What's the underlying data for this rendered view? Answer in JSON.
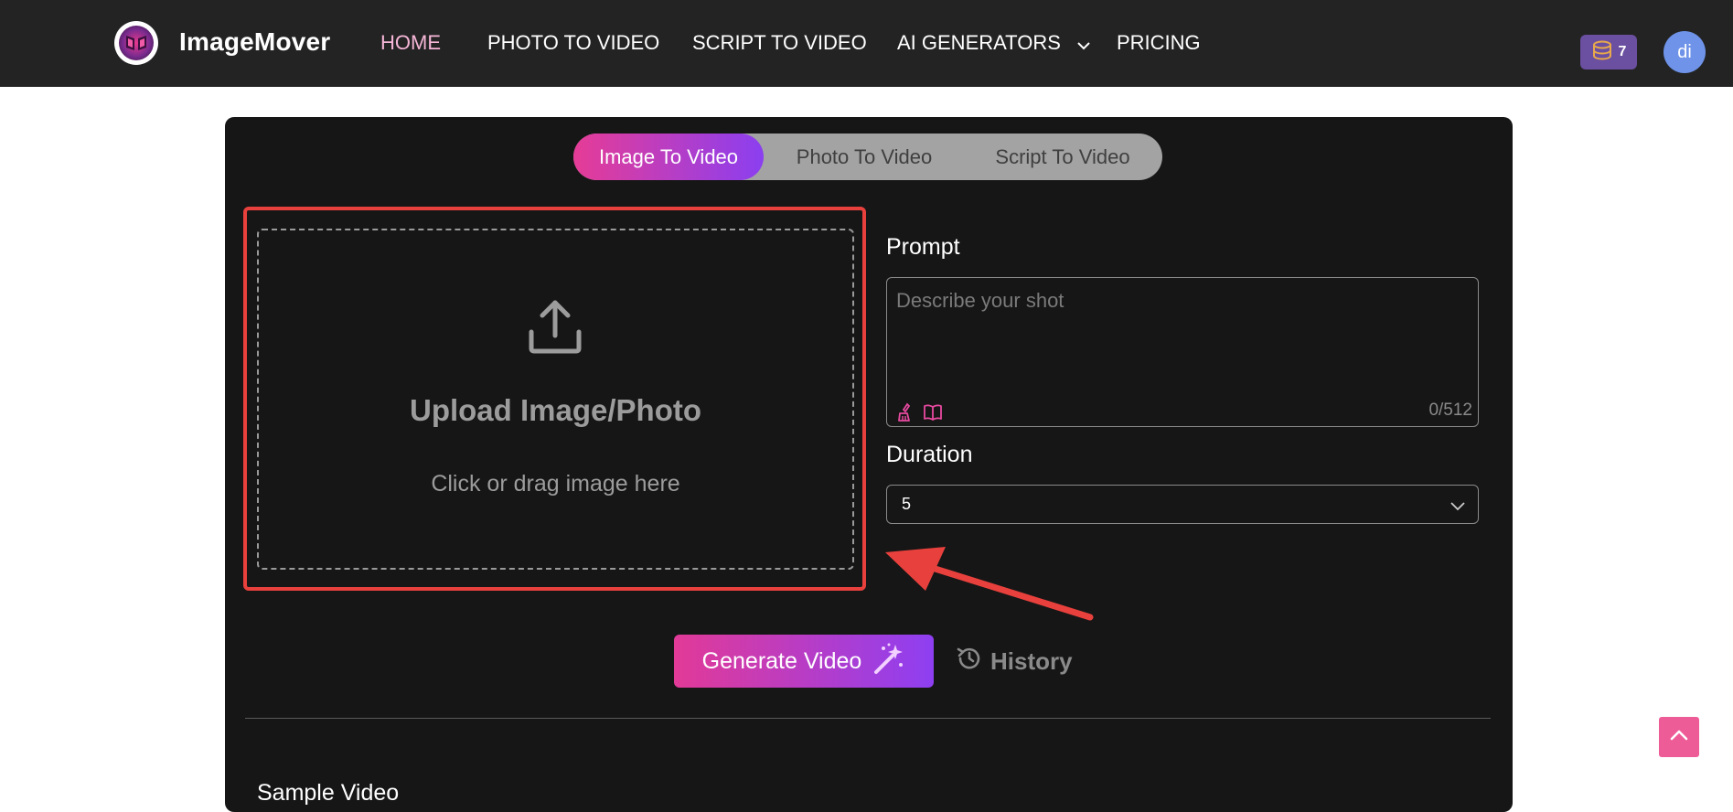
{
  "nav": {
    "brand": "ImageMover",
    "links": [
      "HOME",
      "PHOTO TO VIDEO",
      "SCRIPT TO VIDEO",
      "AI GENERATORS",
      "PRICING"
    ],
    "credits": "7",
    "avatar": "di"
  },
  "tabs": [
    "Image To Video",
    "Photo To Video",
    "Script To Video"
  ],
  "upload": {
    "title": "Upload Image/Photo",
    "subtitle": "Click or drag image here"
  },
  "prompt": {
    "label": "Prompt",
    "placeholder": "Describe your shot",
    "counter": "0/512"
  },
  "duration": {
    "label": "Duration",
    "value": "5"
  },
  "actions": {
    "generate": "Generate Video",
    "history": "History"
  },
  "section": {
    "title": "Sample Video"
  },
  "colors": {
    "accent_pink": "#e63c96",
    "accent_purple": "#8b3ff0",
    "highlight_red": "#e8413d",
    "navbar": "#232323",
    "panel": "#161616"
  }
}
